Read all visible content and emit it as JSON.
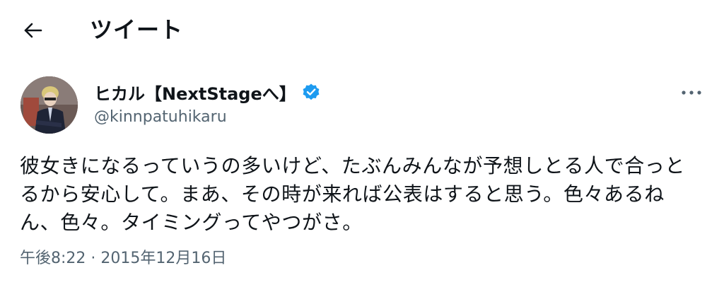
{
  "header": {
    "back_icon": "arrow-left-icon",
    "title": "ツイート"
  },
  "tweet": {
    "author": {
      "display_name": "ヒカル【NextStageへ】",
      "handle": "@kinnpatuhikaru",
      "verified_icon": "verified-badge-icon",
      "verified_color": "#1d9bf0"
    },
    "more_icon": "more-horizontal-icon",
    "text": "彼女きになるっていうの多いけど、たぶんみんなが予想しとる人で合っと\nるから安心して。まあ、その時が来れば公表はすると思う。色々あるね\nん、色々。タイミングってやつがさ。",
    "timestamp": "午後8:22 · 2015年12月16日"
  },
  "colors": {
    "text_primary": "#0f1419",
    "text_secondary": "#536471",
    "background": "#ffffff"
  }
}
